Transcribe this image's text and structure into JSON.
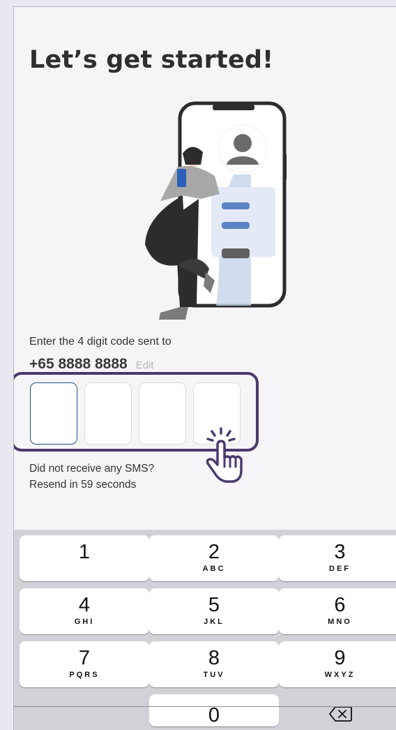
{
  "header": {
    "title": "Let’s get started!"
  },
  "verification": {
    "prompt": "Enter the 4 digit code sent to",
    "phone_number": "+65 8888 8888",
    "edit_label": "Edit",
    "code_digits": [
      "",
      "",
      "",
      ""
    ],
    "no_sms_text": "Did not receive any SMS?",
    "resend_text": "Resend in 59 seconds"
  },
  "keypad": {
    "keys": [
      {
        "digit": "1",
        "letters": ""
      },
      {
        "digit": "2",
        "letters": "ABC"
      },
      {
        "digit": "3",
        "letters": "DEF"
      },
      {
        "digit": "4",
        "letters": "GHI"
      },
      {
        "digit": "5",
        "letters": "JKL"
      },
      {
        "digit": "6",
        "letters": "MNO"
      },
      {
        "digit": "7",
        "letters": "PQRS"
      },
      {
        "digit": "8",
        "letters": "TUV"
      },
      {
        "digit": "9",
        "letters": "WXYZ"
      },
      {
        "digit": "0",
        "letters": ""
      }
    ],
    "delete_icon": "backspace-icon"
  },
  "icons": {
    "illustration": "woman-with-phone-illustration",
    "pointer": "hand-pointer-icon"
  },
  "colors": {
    "highlight_border": "#4a3a6e",
    "active_box_border": "#1c4f86",
    "keypad_bg": "#d3d1d8"
  }
}
